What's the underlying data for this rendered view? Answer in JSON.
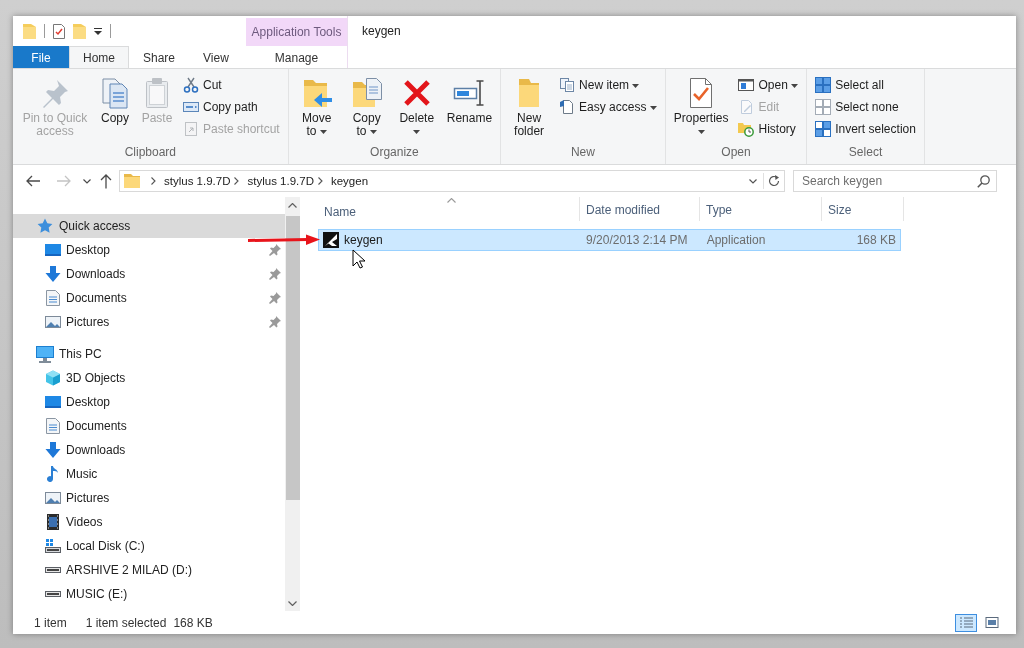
{
  "window": {
    "title": "keygen"
  },
  "ribbon": {
    "contextual_header": "Application Tools",
    "tabs": [
      {
        "label": "File",
        "kind": "file",
        "selected": false
      },
      {
        "label": "Home",
        "kind": "tab",
        "selected": true
      },
      {
        "label": "Share",
        "kind": "tab",
        "selected": false
      },
      {
        "label": "View",
        "kind": "tab",
        "selected": false
      },
      {
        "label": "Manage",
        "kind": "contextual",
        "selected": false
      }
    ],
    "groups": [
      {
        "label": "Clipboard",
        "items": [
          {
            "kind": "pin",
            "label": "Pin to Quick access",
            "disabled": true,
            "dropdown": false
          },
          {
            "kind": "copy",
            "label": "Copy",
            "disabled": false,
            "dropdown": false
          },
          {
            "kind": "paste",
            "label": "Paste",
            "disabled": true,
            "dropdown": false
          },
          {
            "kind": "cut",
            "label": "Cut",
            "disabled": false,
            "dropdown": false
          },
          {
            "kind": "copypath",
            "label": "Copy path",
            "disabled": false,
            "dropdown": false
          },
          {
            "kind": "pasteshortcut",
            "label": "Paste shortcut",
            "disabled": true,
            "dropdown": false
          }
        ]
      },
      {
        "label": "Organize",
        "items": [
          {
            "kind": "moveto",
            "label": "Move to",
            "disabled": false,
            "dropdown": true
          },
          {
            "kind": "copyto",
            "label": "Copy to",
            "disabled": false,
            "dropdown": true
          },
          {
            "kind": "delete",
            "label": "Delete",
            "disabled": false,
            "dropdown": true
          },
          {
            "kind": "rename",
            "label": "Rename",
            "disabled": false,
            "dropdown": false
          }
        ]
      },
      {
        "label": "New",
        "items": [
          {
            "kind": "newfolder",
            "label": "New folder",
            "disabled": false,
            "dropdown": false
          },
          {
            "kind": "newitem",
            "label": "New item",
            "disabled": false,
            "dropdown": true
          },
          {
            "kind": "easyaccess",
            "label": "Easy access",
            "disabled": false,
            "dropdown": true
          }
        ]
      },
      {
        "label": "Open",
        "items": [
          {
            "kind": "properties",
            "label": "Properties",
            "disabled": false,
            "dropdown": true
          },
          {
            "kind": "open",
            "label": "Open",
            "disabled": false,
            "dropdown": true
          },
          {
            "kind": "edit",
            "label": "Edit",
            "disabled": true,
            "dropdown": false
          },
          {
            "kind": "history",
            "label": "History",
            "disabled": false,
            "dropdown": false
          }
        ]
      },
      {
        "label": "Select",
        "items": [
          {
            "kind": "selectall",
            "label": "Select all",
            "disabled": false,
            "dropdown": false
          },
          {
            "kind": "selectnone",
            "label": "Select none",
            "disabled": false,
            "dropdown": false
          },
          {
            "kind": "invertselection",
            "label": "Invert selection",
            "disabled": false,
            "dropdown": false
          }
        ]
      }
    ]
  },
  "navigation_buttons": [
    {
      "kind": "back",
      "disabled": false
    },
    {
      "kind": "forward",
      "disabled": true
    },
    {
      "kind": "recent",
      "disabled": false
    },
    {
      "kind": "up",
      "disabled": false
    }
  ],
  "address_bar": {
    "breadcrumbs": [
      "stylus 1.9.7D",
      "stylus 1.9.7D",
      "keygen"
    ]
  },
  "search": {
    "placeholder": "Search keygen"
  },
  "sidebar": {
    "items": [
      {
        "label": "Quick access",
        "kind": "star",
        "selected": true,
        "children": [
          {
            "label": "Desktop",
            "kind": "desktop",
            "selected": false,
            "pinned": true
          },
          {
            "label": "Downloads",
            "kind": "downloads",
            "selected": false,
            "pinned": true
          },
          {
            "label": "Documents",
            "kind": "documents",
            "selected": false,
            "pinned": true
          },
          {
            "label": "Pictures",
            "kind": "pictures",
            "selected": false,
            "pinned": true
          }
        ]
      },
      {
        "label": "This PC",
        "kind": "pc",
        "selected": false,
        "children": [
          {
            "label": "3D Objects",
            "kind": "objects3d",
            "selected": false,
            "pinned": false
          },
          {
            "label": "Desktop",
            "kind": "desktop",
            "selected": false,
            "pinned": false
          },
          {
            "label": "Documents",
            "kind": "documents",
            "selected": false,
            "pinned": false
          },
          {
            "label": "Downloads",
            "kind": "downloads",
            "selected": false,
            "pinned": false
          },
          {
            "label": "Music",
            "kind": "music",
            "selected": false,
            "pinned": false
          },
          {
            "label": "Pictures",
            "kind": "pictures",
            "selected": false,
            "pinned": false
          },
          {
            "label": "Videos",
            "kind": "videos",
            "selected": false,
            "pinned": false
          },
          {
            "label": "Local Disk (C:)",
            "kind": "systemdrive",
            "selected": false,
            "pinned": false
          },
          {
            "label": "ARSHIVE 2 MILAD (D:)",
            "kind": "drive",
            "selected": false,
            "pinned": false
          },
          {
            "label": "MUSIC (E:)",
            "kind": "drive",
            "selected": false,
            "pinned": false
          }
        ]
      }
    ]
  },
  "file_list": {
    "columns": [
      {
        "label": "Name",
        "sorted": true
      },
      {
        "label": "Date modified",
        "sorted": false
      },
      {
        "label": "Type",
        "sorted": false
      },
      {
        "label": "Size",
        "sorted": false
      }
    ],
    "rows": [
      {
        "name": "keygen",
        "date_modified": "9/20/2013 2:14 PM",
        "type": "Application",
        "size": "168 KB",
        "selected": true
      }
    ]
  },
  "status_bar": {
    "item_count": "1 item",
    "selection": "1 item selected",
    "selection_size": "168 KB",
    "views": [
      {
        "kind": "details",
        "selected": true
      },
      {
        "kind": "largeicons",
        "selected": false
      }
    ]
  }
}
